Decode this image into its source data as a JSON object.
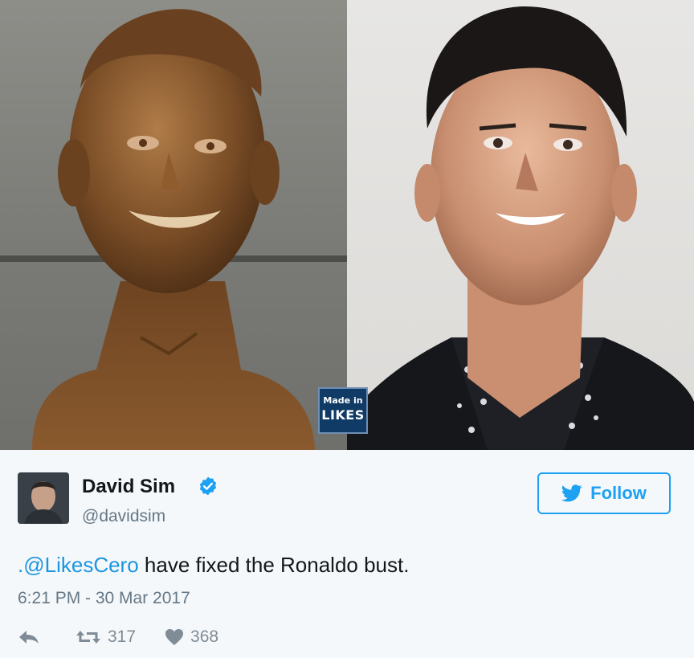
{
  "media": {
    "left_image": "bronze-bust-photo",
    "right_image": "edited-portrait-photo",
    "watermark": {
      "line1": "Made in",
      "line2": "LIKES"
    }
  },
  "tweet": {
    "author_name": "David Sim",
    "author_handle": "@davidsim",
    "follow_label": "Follow",
    "mention": ".@LikesCero",
    "text_rest": " have fixed the Ronaldo bust.",
    "timestamp": "6:21 PM - 30 Mar 2017",
    "retweet_count": "317",
    "like_count": "368",
    "colors": {
      "accent": "#1da1f2",
      "verified": "#1da1f2",
      "muted": "#657786",
      "text": "#14171a"
    },
    "icons": [
      "verified-badge-icon",
      "twitter-bird-icon",
      "reply-icon",
      "retweet-icon",
      "heart-icon"
    ]
  }
}
